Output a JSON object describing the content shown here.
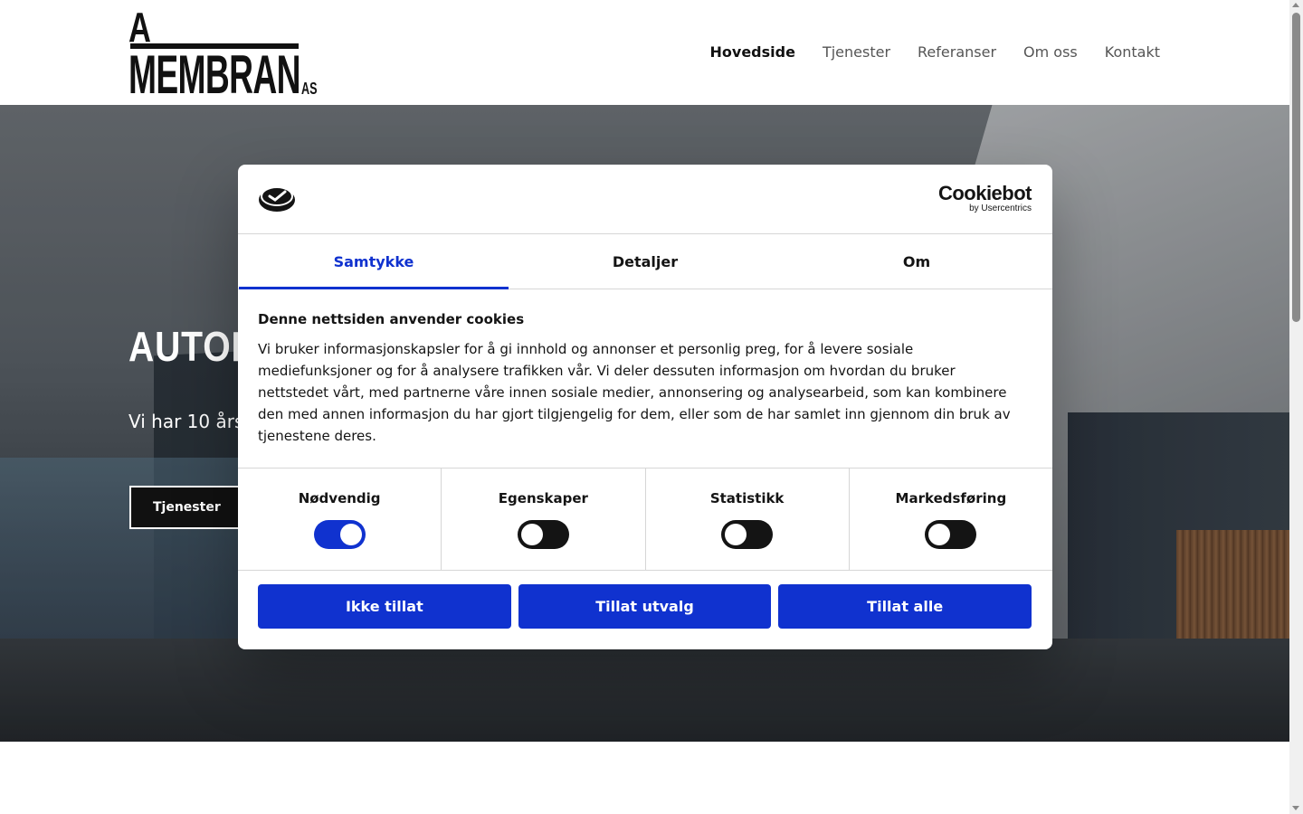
{
  "header": {
    "logo": {
      "line1": "A",
      "line2": "MEMBRAN",
      "suffix": "AS"
    },
    "nav": [
      {
        "label": "Hovedside",
        "active": true
      },
      {
        "label": "Tjenester",
        "active": false
      },
      {
        "label": "Referanser",
        "active": false
      },
      {
        "label": "Om oss",
        "active": false
      },
      {
        "label": "Kontakt",
        "active": false
      }
    ]
  },
  "hero": {
    "title": "AUTOR",
    "subtitle": "Vi har 10 års",
    "button_label": "Tjenester"
  },
  "cookie_dialog": {
    "brand_name": "Cookiebot",
    "brand_by": "by Usercentrics",
    "tabs": [
      {
        "label": "Samtykke",
        "active": true
      },
      {
        "label": "Detaljer",
        "active": false
      },
      {
        "label": "Om",
        "active": false
      }
    ],
    "title": "Denne nettsiden anvender cookies",
    "text": "Vi bruker informasjonskapsler for å gi innhold og annonser et personlig preg, for å levere sosiale mediefunksjoner og for å analysere trafikken vår. Vi deler dessuten informasjon om hvordan du bruker nettstedet vårt, med partnerne våre innen sosiale medier, annonsering og analysearbeid, som kan kombinere den med annen informasjon du har gjort tilgjengelig for dem, eller som de har samlet inn gjennom din bruk av tjenestene deres.",
    "toggles": [
      {
        "label": "Nødvendig",
        "on": true
      },
      {
        "label": "Egenskaper",
        "on": false
      },
      {
        "label": "Statistikk",
        "on": false
      },
      {
        "label": "Markedsføring",
        "on": false
      }
    ],
    "buttons": {
      "deny": "Ikke tillat",
      "allow_selection": "Tillat utvalg",
      "allow_all": "Tillat alle"
    },
    "accent_color": "#1032cf"
  }
}
